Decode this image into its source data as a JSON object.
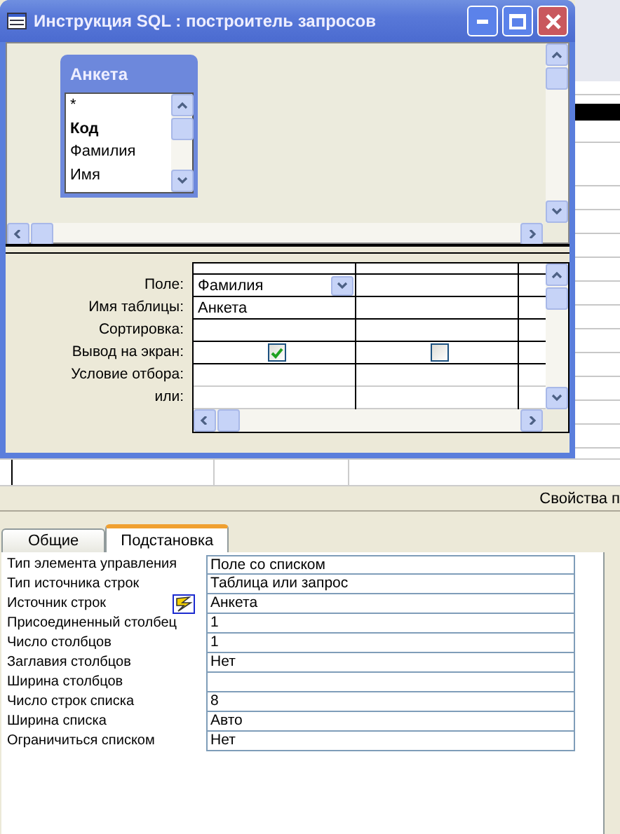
{
  "window": {
    "title": "Инструкция SQL : построитель запросов"
  },
  "table_box": {
    "title": "Анкета",
    "fields": [
      {
        "name": "*",
        "bold": false
      },
      {
        "name": "Код",
        "bold": true
      },
      {
        "name": "Фамилия",
        "bold": false
      },
      {
        "name": "Имя",
        "bold": false
      }
    ]
  },
  "grid": {
    "row_labels": [
      "Поле:",
      "Имя таблицы:",
      "Сортировка:",
      "Вывод на экран:",
      "Условие отбора:",
      "или:"
    ],
    "columns": [
      {
        "field": "Фамилия",
        "table": "Анкета",
        "show": true
      },
      {
        "show": false
      }
    ]
  },
  "properties_label": "Свойства п",
  "tabs": [
    {
      "label": "Общие",
      "selected": false
    },
    {
      "label": "Подстановка",
      "selected": true
    }
  ],
  "properties": [
    {
      "name": "Тип элемента управления",
      "value": "Поле со списком",
      "builder_button": false
    },
    {
      "name": "Тип источника строк",
      "value": "Таблица или запрос",
      "builder_button": false
    },
    {
      "name": "Источник строк",
      "value": "Анкета",
      "builder_button": true
    },
    {
      "name": "Присоединенный столбец",
      "value": "1",
      "builder_button": false
    },
    {
      "name": "Число столбцов",
      "value": "1",
      "builder_button": false
    },
    {
      "name": "Заглавия столбцов",
      "value": "Нет",
      "builder_button": false
    },
    {
      "name": "Ширина столбцов",
      "builder_button": false
    },
    {
      "name": "Число строк списка",
      "value": "8",
      "builder_button": false
    },
    {
      "name": "Ширина списка",
      "value": "Авто",
      "builder_button": false
    },
    {
      "name": "Ограничиться списком",
      "value": "Нет",
      "builder_button": false
    }
  ]
}
